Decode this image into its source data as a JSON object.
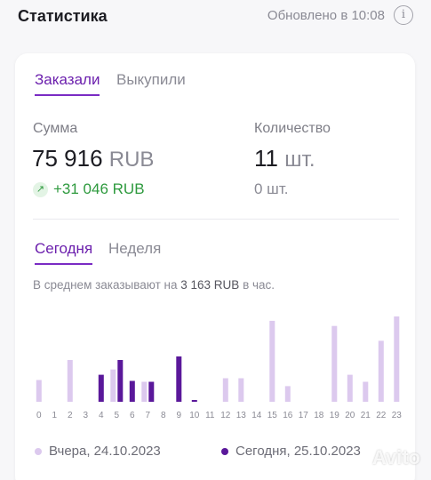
{
  "header": {
    "title": "Статистика",
    "updated": "Обновлено в 10:08",
    "info_icon": "i"
  },
  "tabs_main": [
    {
      "label": "Заказали",
      "active": true
    },
    {
      "label": "Выкупили",
      "active": false
    }
  ],
  "sum": {
    "label": "Сумма",
    "value": "75 916",
    "unit": "RUB",
    "delta": "+31 046 RUB"
  },
  "count": {
    "label": "Количество",
    "value": "11",
    "unit": "шт.",
    "sub": "0 шт."
  },
  "tabs_period": [
    {
      "label": "Сегодня",
      "active": true
    },
    {
      "label": "Неделя",
      "active": false
    }
  ],
  "average": {
    "prefix": "В среднем заказывают на ",
    "value": "3 163 RUB",
    "suffix": " в час."
  },
  "legend": {
    "yesterday": "Вчера, 24.10.2023",
    "today": "Сегодня, 25.10.2023"
  },
  "colors": {
    "accent": "#7a2bc4",
    "yesterday_bar": "#dcc9ee",
    "today_bar": "#5a189a",
    "positive": "#2e9a3e"
  },
  "watermark": "Avito",
  "chart_data": {
    "type": "bar",
    "categories": [
      "0",
      "1",
      "2",
      "3",
      "4",
      "5",
      "6",
      "7",
      "8",
      "9",
      "10",
      "11",
      "12",
      "13",
      "14",
      "15",
      "16",
      "17",
      "18",
      "19",
      "20",
      "21",
      "22",
      "23"
    ],
    "series": [
      {
        "name": "Вчера, 24.10.2023",
        "values": [
          25,
          0,
          48,
          0,
          0,
          37,
          0,
          23,
          0,
          0,
          0,
          0,
          27,
          27,
          0,
          93,
          18,
          0,
          0,
          87,
          31,
          23,
          70,
          98
        ]
      },
      {
        "name": "Сегодня, 25.10.2023",
        "values": [
          0,
          0,
          0,
          0,
          31,
          48,
          24,
          23,
          0,
          52,
          2,
          0,
          0,
          0,
          0,
          0,
          0,
          0,
          0,
          0,
          0,
          0,
          0,
          0
        ]
      }
    ],
    "ylim": [
      0,
      100
    ],
    "grid": false,
    "legend_position": "bottom"
  }
}
